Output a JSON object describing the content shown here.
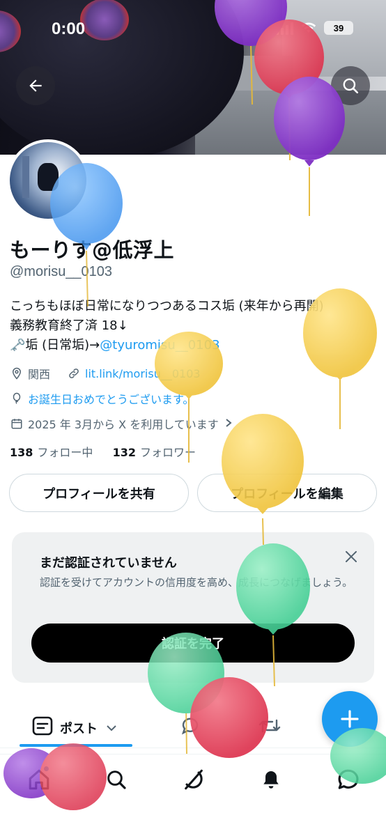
{
  "status_bar": {
    "time": "0:00",
    "battery": "39"
  },
  "profile": {
    "name": "もーりす@低浮上",
    "handle": "@morisu__0103",
    "bio_line1": "こっちもほぼ日常になりつつあるコス垢 (来年から再開)",
    "bio_line2": "義務教育終了済 18↓",
    "bio_line3_prefix": "🗝️垢 (日常垢)→",
    "bio_line3_link": "@tyuromisu__0103",
    "location": "関西",
    "website": "lit.link/morisu__0103",
    "birthday": "お誕生日おめでとうございます。",
    "joined": "2025 年 3月から X を利用しています",
    "following_count": "138",
    "following_label": "フォロー中",
    "followers_count": "132",
    "followers_label": "フォロワー"
  },
  "actions": {
    "share": "プロフィールを共有",
    "edit": "プロフィールを編集"
  },
  "verify_card": {
    "title": "まだ認証されていません",
    "desc": "認証を受けてアカウントの信用度を高め、成長につなげましょう。",
    "button": "認証を完了"
  },
  "tabs": {
    "posts": "ポスト"
  },
  "icons": {
    "back": "back-arrow-icon",
    "search": "search-icon",
    "location": "location-pin-icon",
    "link": "link-icon",
    "birthday": "balloon-icon",
    "calendar": "calendar-icon",
    "close": "close-icon",
    "compose": "plus-icon"
  },
  "colors": {
    "accent": "#1d9bf0",
    "balloon_yellow": "#f2c94c",
    "balloon_purple": "#8e3fd1",
    "balloon_red": "#e84a5f",
    "balloon_blue": "#4fa3f7",
    "balloon_green": "#5fd8a8"
  }
}
